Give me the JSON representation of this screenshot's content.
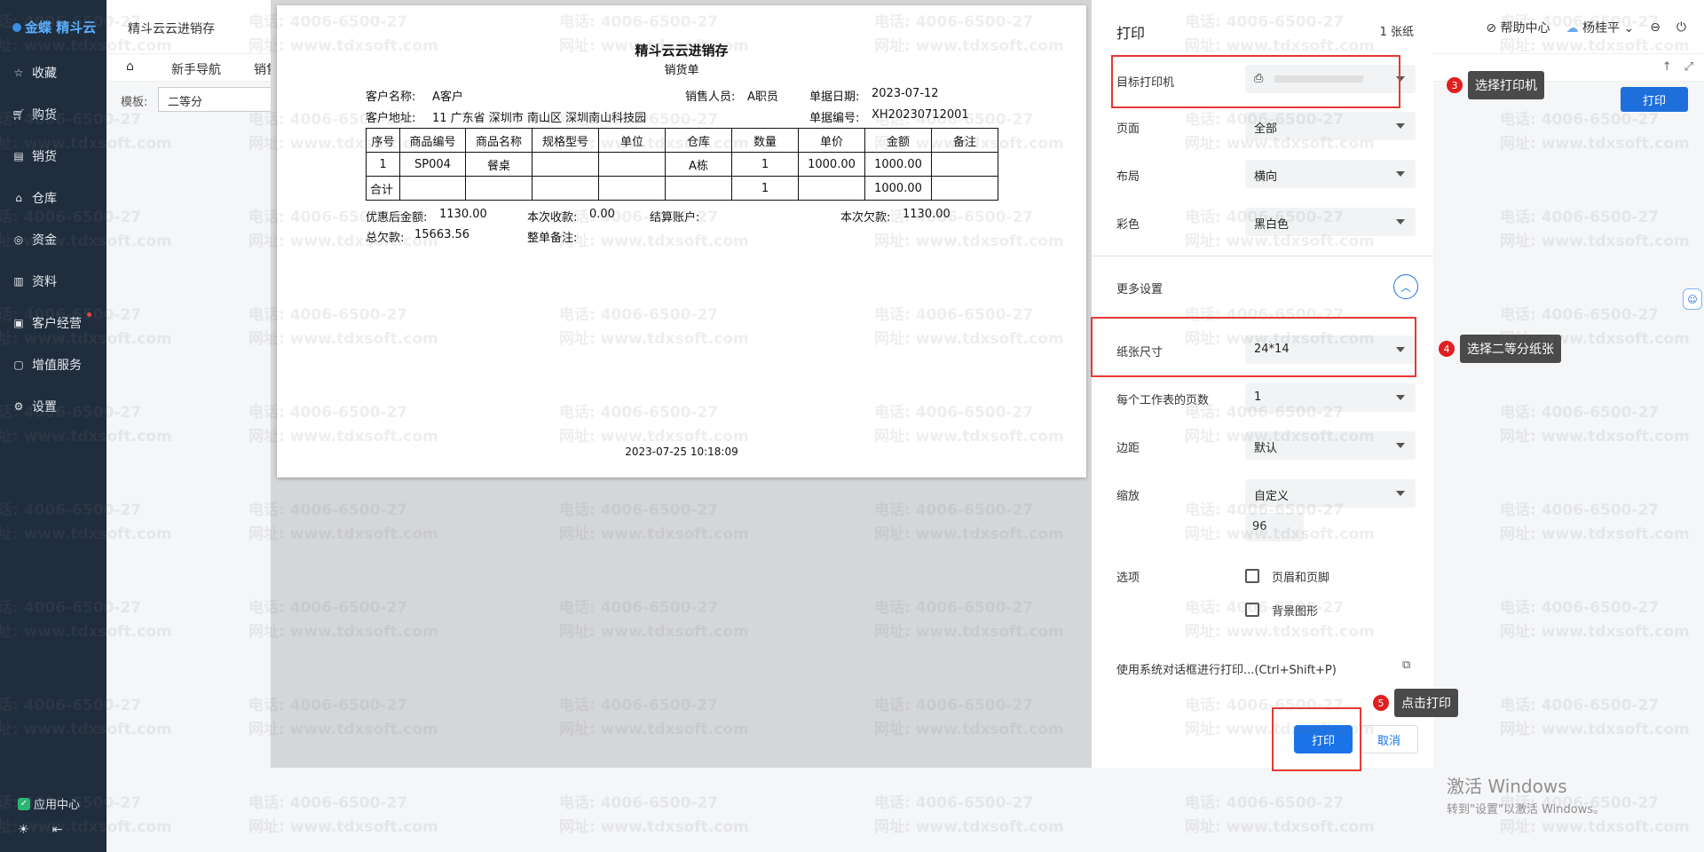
{
  "sidebar": {
    "logo": "金蝶 精斗云",
    "items": [
      {
        "label": "收藏",
        "icon": "star-icon"
      },
      {
        "label": "购货",
        "icon": "cart-icon"
      },
      {
        "label": "销货",
        "icon": "document-icon"
      },
      {
        "label": "仓库",
        "icon": "home-icon"
      },
      {
        "label": "资金",
        "icon": "coin-icon"
      },
      {
        "label": "资料",
        "icon": "file-icon"
      },
      {
        "label": "客户经营",
        "icon": "chart-icon"
      },
      {
        "label": "增值服务",
        "icon": "service-icon"
      },
      {
        "label": "设置",
        "icon": "gear-icon"
      }
    ],
    "app_center": "应用中心"
  },
  "topbar": {
    "app_title": "精斗云云进销存",
    "help": "帮助中心",
    "user": "杨桂平"
  },
  "subbar": {
    "tab_guide": "新手导航",
    "tab_sales": "销售"
  },
  "template": {
    "label": "模板:",
    "value": "二等分"
  },
  "main_print_button": "打印",
  "document": {
    "title": "精斗云云进销存",
    "subtitle": "销货单",
    "customer_name_label": "客户名称:",
    "customer_name": "A客户",
    "salesperson_label": "销售人员:",
    "salesperson": "A职员",
    "date_label": "单据日期:",
    "date": "2023-07-12",
    "address_label": "客户地址:",
    "address": "11 广东省 深圳市 南山区 深圳南山科技园",
    "number_label": "单据编号:",
    "number": "XH20230712001",
    "table_headers": [
      "序号",
      "商品编号",
      "商品名称",
      "规格型号",
      "单位",
      "仓库",
      "数量",
      "单价",
      "金额",
      "备注"
    ],
    "table_rows": [
      [
        "1",
        "SP004",
        "餐桌",
        "",
        "",
        "A栋",
        "1",
        "1000.00",
        "1000.00",
        ""
      ]
    ],
    "total_row": {
      "label": "合计",
      "qty": "1",
      "amount": "1000.00"
    },
    "discount_label": "优惠后金额:",
    "discount": "1130.00",
    "received_label": "本次收款:",
    "received": "0.00",
    "account_label": "结算账户:",
    "owed_label": "本次欠款:",
    "owed": "1130.00",
    "total_owed_label": "总欠款:",
    "total_owed": "15663.56",
    "remark_label": "整单备注:",
    "print_time": "2023-07-25 10:18:09"
  },
  "print_dialog": {
    "title": "打印",
    "sheet_count": "1 张纸",
    "printer_label": "目标打印机",
    "pages_label": "页面",
    "pages_value": "全部",
    "layout_label": "布局",
    "layout_value": "横向",
    "color_label": "彩色",
    "color_value": "黑白色",
    "more_settings": "更多设置",
    "paper_size_label": "纸张尺寸",
    "paper_size_value": "24*14",
    "pages_per_sheet_label": "每个工作表的页数",
    "pages_per_sheet_value": "1",
    "margins_label": "边距",
    "margins_value": "默认",
    "scale_label": "缩放",
    "scale_value": "自定义",
    "scale_input": "96",
    "options_label": "选项",
    "option_headers": "页眉和页脚",
    "option_background": "背景图形",
    "system_dialog": "使用系统对话框进行打印...(Ctrl+Shift+P)",
    "print_button": "打印",
    "cancel_button": "取消"
  },
  "annotations": [
    {
      "num": "3",
      "text": "选择打印机"
    },
    {
      "num": "4",
      "text": "选择二等分纸张"
    },
    {
      "num": "5",
      "text": "点击打印"
    }
  ],
  "watermark": {
    "phone": "电话: 4006-6500-27",
    "site": "网址: www.tdxsoft.com"
  },
  "windows_activation": {
    "line1": "激活 Windows",
    "line2": "转到\"设置\"以激活 Windows。"
  },
  "colors": {
    "sidebar_bg": "#1f2d3d",
    "accent_blue": "#1a73e8",
    "highlight_red": "#e53935"
  }
}
